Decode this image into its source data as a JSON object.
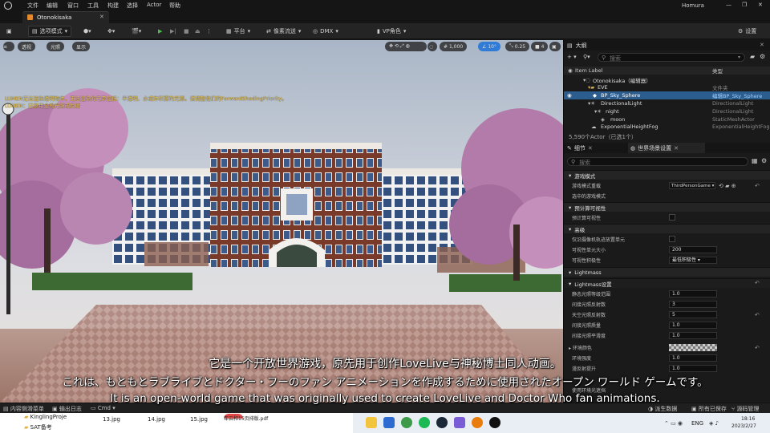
{
  "menubar": {
    "items": [
      "文件",
      "编辑",
      "窗口",
      "工具",
      "构建",
      "选择",
      "Actor",
      "帮助"
    ],
    "user": "Homura"
  },
  "tab": {
    "label": "Otonokisaka"
  },
  "toolbar": {
    "select_mode": "选项模式",
    "platform": "平台",
    "pixel_streaming": "像素流送",
    "dmx": "DMX",
    "vp_role": "VP角色",
    "settings": "设置"
  },
  "viewport": {
    "perspective": "透视",
    "lit": "光照",
    "show": "显示",
    "grid_size": "1,000",
    "rotation_snap": "10°",
    "scale_snap": "0.25",
    "camera_speed": "4",
    "warning_line1": "LUMEN无法渲染透明物体，无法渲染的元素包括：半透明、水或体积雾的光源。请调整他们的ForwardShadingPriority。",
    "warning_line2": "LUMEN：已禁用全局光照或反射"
  },
  "outliner": {
    "title": "大纲",
    "search_placeholder": "搜索",
    "col_label": "Item Label",
    "col_type": "类型",
    "rows": [
      {
        "name": "Otonokisaka（编辑器）",
        "type": ""
      },
      {
        "name": "EVE",
        "type": "文件夹"
      },
      {
        "name": "BP_Sky_Sphere",
        "type": "编辑BP_Sky_Sphere"
      },
      {
        "name": "DirectionalLight",
        "type": "DirectionalLight"
      },
      {
        "name": "night",
        "type": "DirectionalLight"
      },
      {
        "name": "moon",
        "type": "StaticMeshActor"
      },
      {
        "name": "ExponentialHeightFog",
        "type": "ExponentialHeightFog"
      }
    ],
    "status": "5,590个Actor（已选1个）"
  },
  "details": {
    "tab_details": "细节",
    "tab_world": "世界场景设置",
    "search_placeholder": "搜索",
    "sections": {
      "game_mode": "游戏模式",
      "precomputed_visibility": "预计算可视性",
      "broadphase": "高级",
      "lightmass": "Lightmass",
      "lightmass_settings": "Lightmass设置"
    },
    "props": {
      "game_mode_override": "游戏模式重载",
      "game_mode_value": "ThirdPersonGame",
      "selected_game_mode": "选中的游戏模式",
      "precomputed_vis": "预计算可视性",
      "only_camera_cells": "仅沿摄像机轨迹放置单元",
      "vis_cell_size": "可视性单元大小",
      "vis_cell_size_value": "200",
      "vis_aggressiveness": "可视性积极性",
      "vis_aggressiveness_value": "最低积极性",
      "static_light_levels": "静态光照等级范围",
      "static_light_levels_value": "1.0",
      "indirect_bounces": "间接光照反射数",
      "indirect_bounces_value": "3",
      "sky_bounces": "天空光照反射数",
      "sky_bounces_value": "5",
      "indirect_quality": "间接光照质量",
      "indirect_quality_value": "1.0",
      "indirect_smoothness": "间接光照平滑度",
      "indirect_smoothness_value": "1.0",
      "env_color": "环境颜色",
      "env_intensity": "环境强度",
      "env_intensity_value": "1.0",
      "diffuse_boost": "漫反射提升",
      "diffuse_boost_value": "1.0",
      "use_ao": "使用环境光遮挡"
    }
  },
  "bottombar": {
    "content_drawer": "内容侧滑菜单",
    "output_log": "输出日志",
    "cmd": "Cmd",
    "derived_data": "派生数据",
    "all_saved": "所有已保存",
    "source_control": "源码管理"
  },
  "explorer": {
    "folders": [
      "KinglingProje",
      "SAT备考"
    ],
    "files": [
      "13.jpg",
      "14.jpg",
      "15.jpg",
      "车云和15页排版.pdf"
    ]
  },
  "taskbar": {
    "lang": "ENG",
    "time": "18:16",
    "date": "2023/2/27"
  },
  "subtitles": {
    "zh": "它是一个开放世界游戏，原先用于创作LoveLive与神秘博士同人动画。",
    "ja": "これは、もともとラブライブとドクター・フーのファン アニメーションを作成するために使用されたオープン ワールド ゲームです。",
    "en": "It is an open-world game that was originally used to create LoveLive and Doctor Who fan animations."
  },
  "colors": {
    "accent": "#2f7bd6",
    "selected_row": "#2c5d8f",
    "warning": "#f2c94c"
  }
}
